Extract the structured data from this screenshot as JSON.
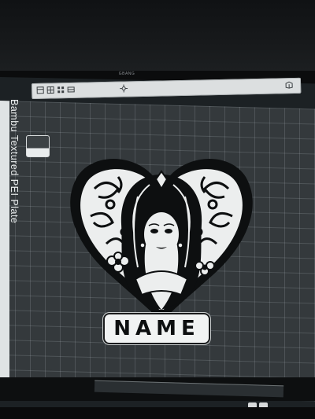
{
  "monitor": {
    "brand_label": "GBANG"
  },
  "toolbar": {
    "icons": [
      "layout-icon",
      "grid-icon",
      "arrange-icon",
      "orient-icon",
      "move-icon",
      "view-cube-icon"
    ]
  },
  "plate": {
    "label": "Bambu Textured PEI Plate"
  },
  "model": {
    "name_text": "NAME",
    "subject": "heart-portrait-emblem"
  },
  "colors": {
    "grid_bg": "#34393c",
    "plate_white": "#f1f3f3",
    "model_black": "#0d0f10"
  }
}
